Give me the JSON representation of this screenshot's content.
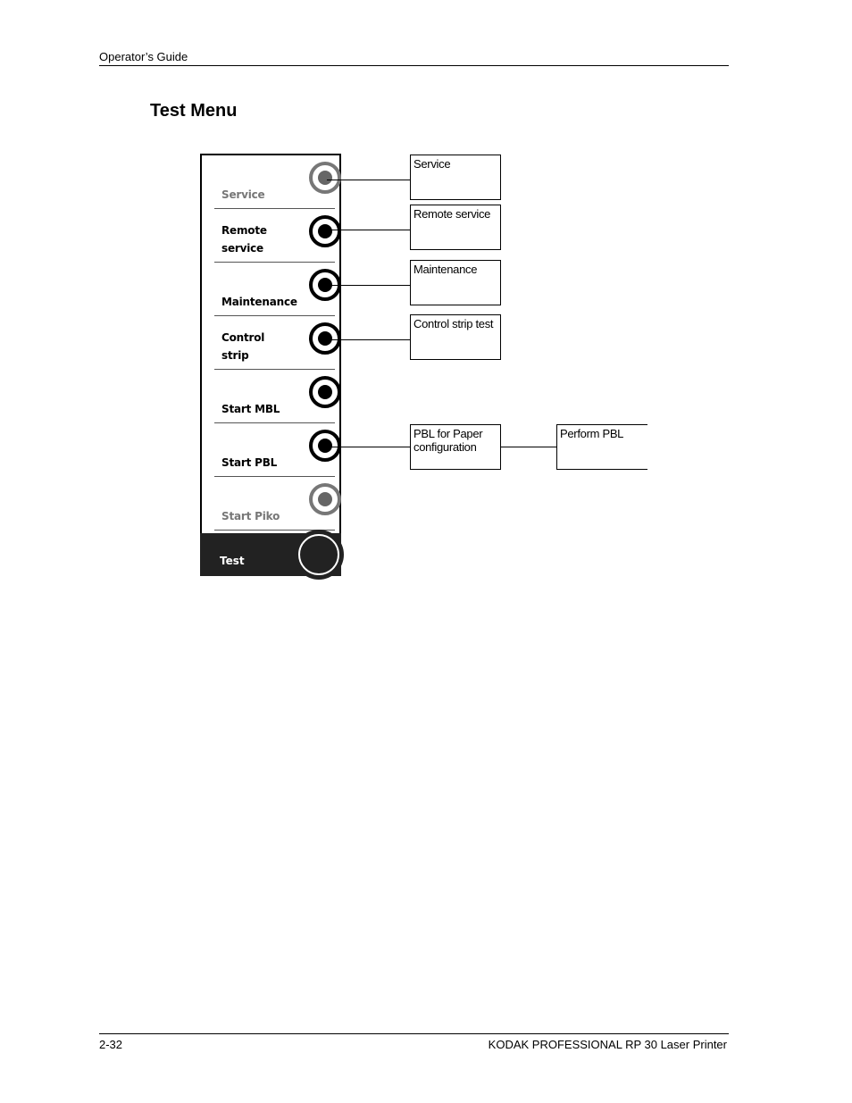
{
  "header": {
    "title": "Operator’s Guide"
  },
  "section_title": "Test Menu",
  "menu": {
    "items": [
      {
        "label_line1": "Service",
        "label_line2": "",
        "state": "dim"
      },
      {
        "label_line1": "Remote",
        "label_line2": "service",
        "state": "active"
      },
      {
        "label_line1": "Maintenance",
        "label_line2": "",
        "state": "active"
      },
      {
        "label_line1": "Control",
        "label_line2": "strip",
        "state": "active"
      },
      {
        "label_line1": "Start MBL",
        "label_line2": "",
        "state": "active"
      },
      {
        "label_line1": "Start PBL",
        "label_line2": "",
        "state": "active"
      },
      {
        "label_line1": "Start Piko",
        "label_line2": "",
        "state": "dim"
      }
    ],
    "selected": {
      "label": "Test"
    }
  },
  "boxes": {
    "service": "Service",
    "remote_service": "Remote service",
    "maintenance": "Maintenance",
    "control_strip": "Control strip test",
    "pbl_line1": "PBL for Paper",
    "pbl_line2": "configuration",
    "perform_pbl": "Perform PBL"
  },
  "footer": {
    "page_number": "2-32",
    "product": "KODAK PROFESSIONAL RP 30 Laser Printer"
  }
}
